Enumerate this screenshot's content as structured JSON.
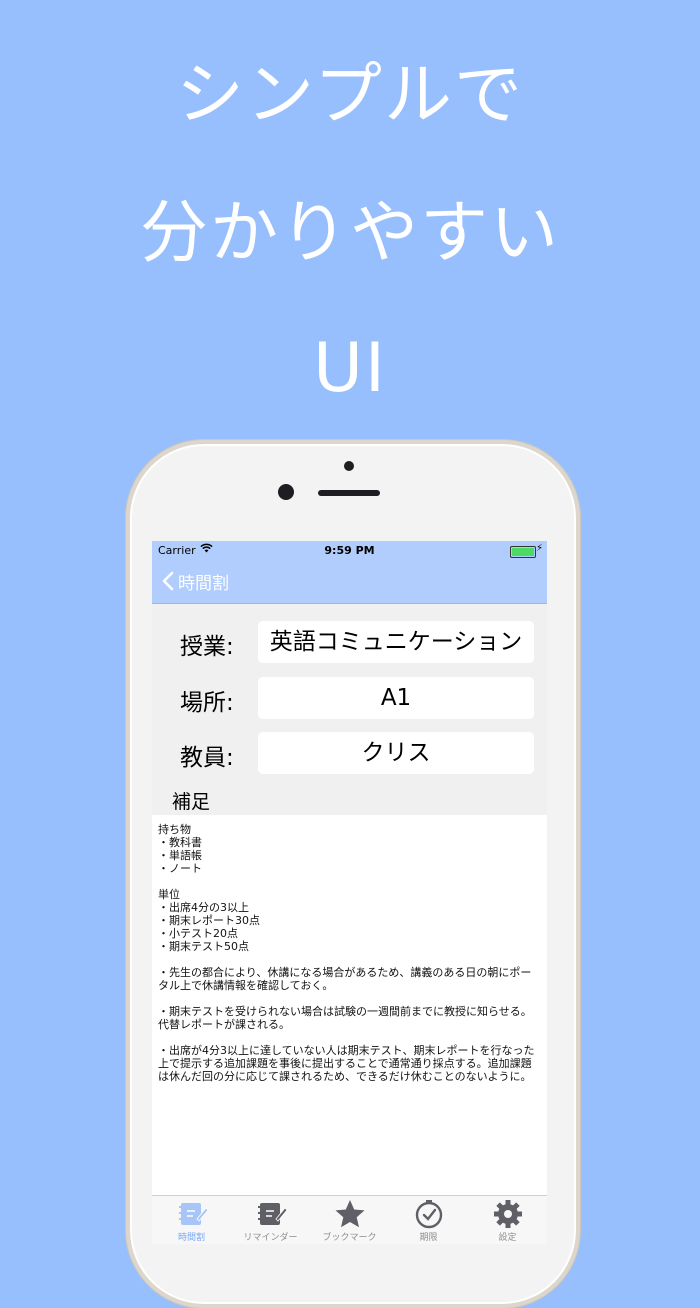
{
  "headline": {
    "line1": "シンプルで",
    "line2": "分かりやすい",
    "line3": "UI"
  },
  "status_bar": {
    "carrier": "Carrier",
    "time": "9:59 PM"
  },
  "nav": {
    "back_label": "時間割"
  },
  "fields": [
    {
      "label": "授業:",
      "value": "英語コミュニケーション"
    },
    {
      "label": "場所:",
      "value": "A1"
    },
    {
      "label": "教員:",
      "value": "クリス"
    }
  ],
  "notes": {
    "label": "補足",
    "text": "持ち物\n・教科書\n・単語帳\n・ノート\n\n単位\n・出席4分の3以上\n・期末レポート30点\n・小テスト20点\n・期末テスト50点\n\n・先生の都合により、休講になる場合があるため、講義のある日の朝にポータル上で休講情報を確認しておく。\n\n・期末テストを受けられない場合は試験の一週間前までに教授に知らせる。代替レポートが課される。\n\n・出席が4分3以上に達していない人は期末テスト、期末レポートを行なった上で提示する追加課題を事後に提出することで通常通り採点する。追加課題は休んだ回の分に応じて課されるため、できるだけ休むことのないように。"
  },
  "tabs": [
    {
      "label": "時間割",
      "icon": "timetable-icon",
      "active": true
    },
    {
      "label": "リマインダー",
      "icon": "reminder-icon",
      "active": false
    },
    {
      "label": "ブックマーク",
      "icon": "star-icon",
      "active": false
    },
    {
      "label": "期限",
      "icon": "clock-icon",
      "active": false
    },
    {
      "label": "設定",
      "icon": "gear-icon",
      "active": false
    }
  ],
  "colors": {
    "background": "#97bffd",
    "nav_bar": "#b1cdfd",
    "tab_active": "#7aa7f3",
    "tab_inactive": "#8e8e93"
  }
}
